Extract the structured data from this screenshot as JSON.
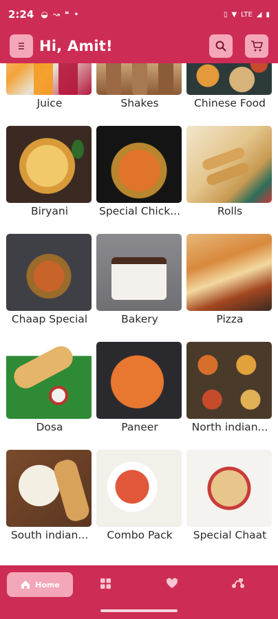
{
  "status": {
    "time": "2:24",
    "signal_label": "LTE"
  },
  "header": {
    "greeting": "Hi, Amit!",
    "menu_icon": "menu-icon",
    "search_icon": "search-icon",
    "cart_icon": "cart-icon"
  },
  "categories": [
    {
      "label": "Juice"
    },
    {
      "label": "Shakes"
    },
    {
      "label": "Chinese Food"
    },
    {
      "label": "Biryani"
    },
    {
      "label": "Special Chick..."
    },
    {
      "label": "Rolls"
    },
    {
      "label": "Chaap Special"
    },
    {
      "label": "Bakery"
    },
    {
      "label": "Pizza"
    },
    {
      "label": "Dosa"
    },
    {
      "label": "Paneer"
    },
    {
      "label": "North indian..."
    },
    {
      "label": "South indian..."
    },
    {
      "label": "Combo Pack"
    },
    {
      "label": "Special Chaat"
    }
  ],
  "nav": {
    "home_label": "Home",
    "items": [
      "home-icon",
      "grid-icon",
      "heart-icon",
      "delivery-icon"
    ]
  },
  "colors": {
    "brand": "#cd2d55",
    "accent": "#f4a7b8"
  }
}
